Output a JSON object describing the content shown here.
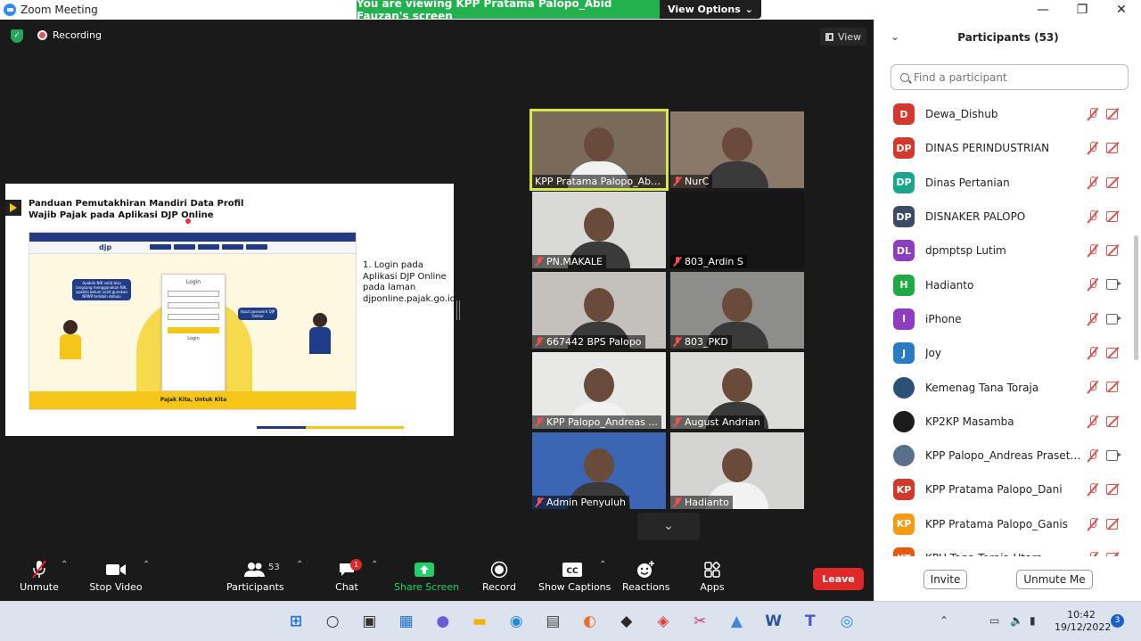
{
  "window": {
    "title": "Zoom Meeting",
    "viewing_banner": "You are viewing KPP Pratama Palopo_Abid Fauzan's screen",
    "view_options_label": "View Options",
    "view_button_label": "View",
    "recording_label": "Recording"
  },
  "slide": {
    "title": "Panduan Pemutakhiran Mandiri Data Profil Wajib Pajak pada Aplikasi DJP Online",
    "step_text": "1.   Login pada Aplikasi DJP Online pada laman djponline.pajak.go.id",
    "screenshot": {
      "logo": "djp",
      "login_title": "Login",
      "login_button": "Login",
      "bubble_left": "Apabila NIK valid bisa langsung menggunakan NIK, apabila belum valid gunakan NPWP terlebih dahulu",
      "bubble_right": "Input password DJP Online",
      "footer": "Pajak Kita, Untuk Kita"
    }
  },
  "video_tiles": [
    {
      "name": "KPP Pratama Palopo_Abi...",
      "muted": false,
      "active": true,
      "bg": "#7a6a5a"
    },
    {
      "name": "NurC",
      "muted": true,
      "active": false,
      "bg": "#8a7868"
    },
    {
      "name": "PN.MAKALE",
      "muted": true,
      "active": false,
      "bg": "#d9d9d6"
    },
    {
      "name": "803_Ardin S",
      "muted": true,
      "active": false,
      "bg": "#151515"
    },
    {
      "name": "667442 BPS Palopo",
      "muted": true,
      "active": false,
      "bg": "#c4c0bb"
    },
    {
      "name": "803_PKD",
      "muted": true,
      "active": false,
      "bg": "#8d8d8b"
    },
    {
      "name": "KPP Palopo_Andreas ...",
      "muted": true,
      "active": false,
      "bg": "#e8e8e6"
    },
    {
      "name": "August Andrian",
      "muted": true,
      "active": false,
      "bg": "#dcdcda"
    },
    {
      "name": "Admin Penyuluh",
      "muted": true,
      "active": false,
      "bg": "#3a66b4"
    },
    {
      "name": "Hadianto",
      "muted": true,
      "active": false,
      "bg": "#d4d4d2"
    }
  ],
  "toolbar": {
    "unmute": "Unmute",
    "stop_video": "Stop Video",
    "participants": "Participants",
    "participants_count": "53",
    "chat": "Chat",
    "chat_badge": "1",
    "share_screen": "Share Screen",
    "record": "Record",
    "show_captions": "Show Captions",
    "reactions": "Reactions",
    "apps": "Apps",
    "leave": "Leave",
    "share_color": "#22d06a",
    "leave_color": "#e02828"
  },
  "participants_panel": {
    "title": "Participants (53)",
    "search_placeholder": "Find a participant",
    "invite": "Invite",
    "unmute_me": "Unmute Me",
    "items": [
      {
        "initials": "D",
        "name": "Dewa_Dishub",
        "color": "#d0392b",
        "cam": "off"
      },
      {
        "initials": "DP",
        "name": "DINAS PERINDUSTRIAN",
        "color": "#d0392b",
        "cam": "off"
      },
      {
        "initials": "DP",
        "name": "Dinas Pertanian",
        "color": "#1aa68a",
        "cam": "off"
      },
      {
        "initials": "DP",
        "name": "DISNAKER PALOPO",
        "color": "#3c4a66",
        "cam": "off"
      },
      {
        "initials": "DL",
        "name": "dpmptsp Lutim",
        "color": "#8e3cc2",
        "cam": "off"
      },
      {
        "initials": "H",
        "name": "Hadianto",
        "color": "#22a845",
        "cam": "on"
      },
      {
        "initials": "I",
        "name": "iPhone",
        "color": "#8e3cc2",
        "cam": "on"
      },
      {
        "initials": "J",
        "name": "Joy",
        "color": "#2b7bc4",
        "cam": "off"
      },
      {
        "initials": "",
        "name": "Kemenag Tana Toraja",
        "color": "#2a5276",
        "cam": "off"
      },
      {
        "initials": "",
        "name": "KP2KP Masamba",
        "color": "#1c1c1c",
        "cam": "off"
      },
      {
        "initials": "",
        "name": "KPP Palopo_Andreas Prasetyo ...",
        "color": "#5a6f8a",
        "cam": "on"
      },
      {
        "initials": "KP",
        "name": "KPP Pratama Palopo_Dani",
        "color": "#d0392b",
        "cam": "off"
      },
      {
        "initials": "KP",
        "name": "KPP Pratama Palopo_Ganis",
        "color": "#f39c12",
        "cam": "off"
      },
      {
        "initials": "KT",
        "name": "KPU Tana Toraja Utara",
        "color": "#e65a0f",
        "cam": "off"
      }
    ]
  },
  "taskbar": {
    "time": "10:42",
    "date": "19/12/2022",
    "notification_count": "3",
    "icons": [
      "windows-start-icon",
      "search-icon",
      "task-view-icon",
      "widgets-icon",
      "teams-chat-icon",
      "file-explorer-icon",
      "edge-icon",
      "store-icon",
      "firefox-icon",
      "dropbox-icon",
      "anydesk-icon",
      "snipping-tool-icon",
      "photos-icon",
      "word-icon",
      "teams-icon",
      "zoom-icon"
    ]
  }
}
